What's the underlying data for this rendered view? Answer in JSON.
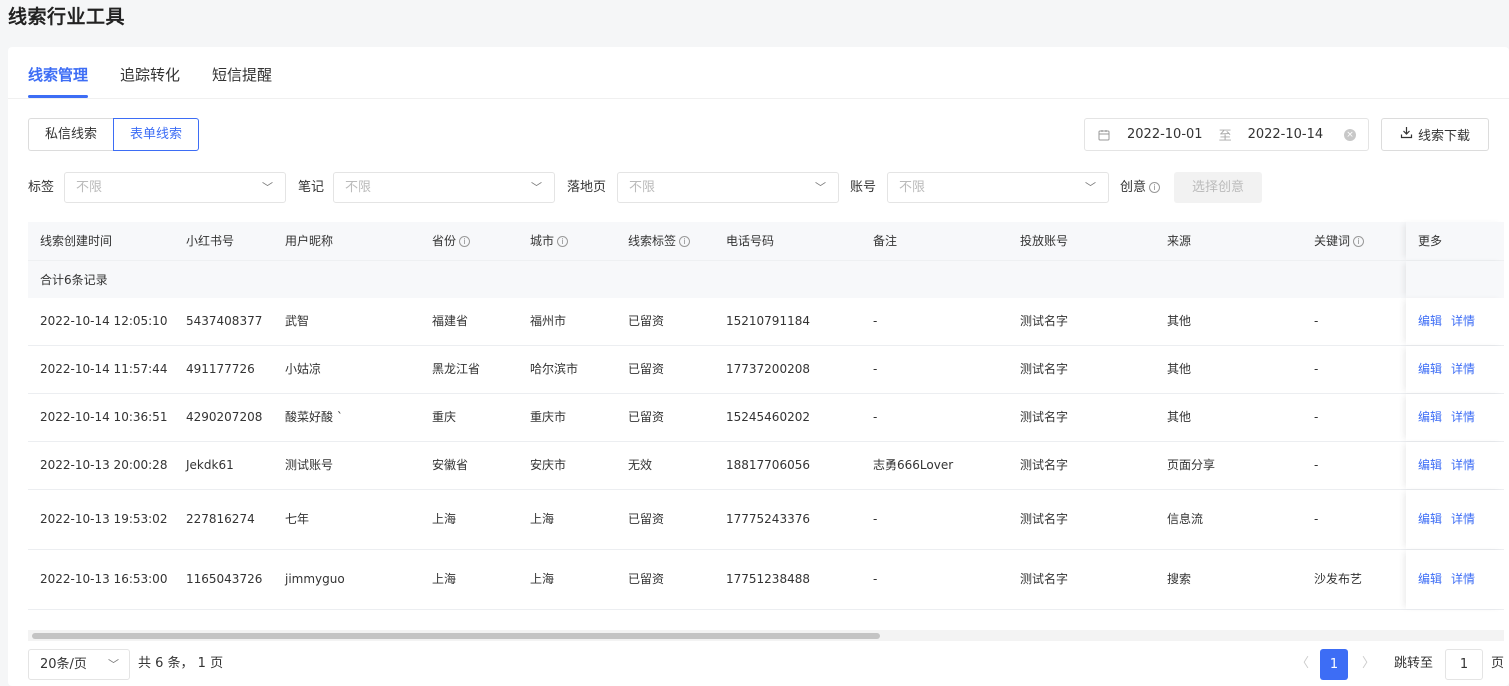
{
  "page_title": "线索行业工具",
  "tabs": [
    {
      "label": "线索管理",
      "active": true
    },
    {
      "label": "追踪转化",
      "active": false
    },
    {
      "label": "短信提醒",
      "active": false
    }
  ],
  "segment": [
    {
      "label": "私信线索",
      "active": false
    },
    {
      "label": "表单线索",
      "active": true
    }
  ],
  "date_range": {
    "start": "2022-10-01",
    "separator": "至",
    "end": "2022-10-14"
  },
  "download_label": "线索下载",
  "filters": [
    {
      "label": "标签",
      "placeholder": "不限"
    },
    {
      "label": "笔记",
      "placeholder": "不限"
    },
    {
      "label": "落地页",
      "placeholder": "不限"
    },
    {
      "label": "账号",
      "placeholder": "不限"
    }
  ],
  "creative": {
    "label": "创意",
    "button": "选择创意"
  },
  "columns": [
    "线索创建时间",
    "小红书号",
    "用户昵称",
    "省份",
    "城市",
    "线索标签",
    "电话号码",
    "备注",
    "投放账号",
    "来源",
    "关键词",
    "更多"
  ],
  "summary": "合计6条记录",
  "row_actions": {
    "edit": "编辑",
    "detail": "详情"
  },
  "rows": [
    [
      "2022-10-14 12:05:10",
      "5437408377",
      "武智",
      "福建省",
      "福州市",
      "已留资",
      "15210791184",
      "-",
      "测试名字",
      "其他",
      "-"
    ],
    [
      "2022-10-14 11:57:44",
      "491177726",
      "小姑凉",
      "黑龙江省",
      "哈尔滨市",
      "已留资",
      "17737200208",
      "-",
      "测试名字",
      "其他",
      "-"
    ],
    [
      "2022-10-14 10:36:51",
      "4290207208",
      "酸菜好酸 `",
      "重庆",
      "重庆市",
      "已留资",
      "15245460202",
      "-",
      "测试名字",
      "其他",
      "-"
    ],
    [
      "2022-10-13 20:00:28",
      "Jekdk61",
      "测试账号",
      "安徽省",
      "安庆市",
      "无效",
      "18817706056",
      "志勇666Lover",
      "测试名字",
      "页面分享",
      "-"
    ],
    [
      "2022-10-13 19:53:02",
      "227816274",
      "七年",
      "上海",
      "上海",
      "已留资",
      "17775243376",
      "-",
      "测试名字",
      "信息流",
      "-"
    ],
    [
      "2022-10-13 16:53:00",
      "1165043726",
      "jimmyguo",
      "上海",
      "上海",
      "已留资",
      "17751238488",
      "-",
      "测试名字",
      "搜索",
      "沙发布艺"
    ]
  ],
  "pager": {
    "page_size": "20条/页",
    "total": "共 6 条， 1 页",
    "current": "1",
    "jump_label": "跳转至",
    "jump_value": "1",
    "jump_suffix": "页"
  }
}
